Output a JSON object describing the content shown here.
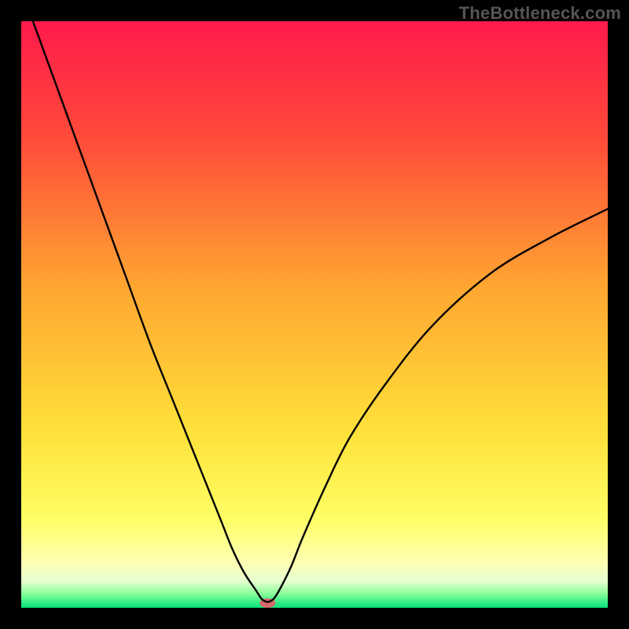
{
  "watermark": "TheBottleneck.com",
  "chart_data": {
    "type": "line",
    "title": "",
    "xlabel": "",
    "ylabel": "",
    "xlim": [
      0,
      100
    ],
    "ylim": [
      0,
      100
    ],
    "grid": false,
    "legend": false,
    "background_gradient_stops": [
      {
        "offset": 0.0,
        "color": "#ff1a4b"
      },
      {
        "offset": 0.2,
        "color": "#ff4b3a"
      },
      {
        "offset": 0.45,
        "color": "#ffa531"
      },
      {
        "offset": 0.7,
        "color": "#ffe13a"
      },
      {
        "offset": 0.85,
        "color": "#ffff66"
      },
      {
        "offset": 0.92,
        "color": "#ffffb0"
      },
      {
        "offset": 0.955,
        "color": "#e6ffd0"
      },
      {
        "offset": 0.975,
        "color": "#8fff9b"
      },
      {
        "offset": 1.0,
        "color": "#00e37a"
      }
    ],
    "series": [
      {
        "name": "bottleneck-curve",
        "color": "#000000",
        "x": [
          2,
          6,
          10,
          14,
          18,
          22,
          26,
          30,
          34,
          36,
          38,
          40,
          41,
          42,
          43,
          44,
          46,
          48,
          52,
          56,
          62,
          70,
          80,
          90,
          100
        ],
        "y": [
          100,
          89,
          78,
          67,
          56,
          45,
          35,
          25,
          15,
          10,
          6,
          3,
          1.5,
          1,
          1.5,
          3,
          7,
          12,
          21,
          29,
          38,
          48,
          57,
          63,
          68
        ]
      }
    ],
    "marker": {
      "x": 42,
      "y": 0.8,
      "color": "#d46a6a",
      "rx": 10,
      "ry": 6
    }
  }
}
